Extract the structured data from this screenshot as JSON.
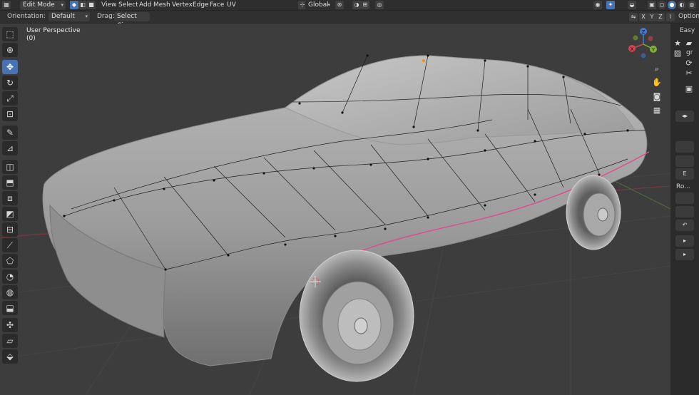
{
  "header": {
    "mode": "Edit Mode",
    "menus": [
      "View",
      "Select",
      "Add",
      "Mesh",
      "Vertex",
      "Edge",
      "Face",
      "UV"
    ],
    "transform_orientation": "Global",
    "axes": [
      "X",
      "Y",
      "Z"
    ],
    "options_label": "Options"
  },
  "tool_settings": {
    "orientation_label": "Orientation:",
    "orientation_value": "Default",
    "drag_label": "Drag:",
    "drag_value": "Select Cir..."
  },
  "viewport": {
    "view_name": "User Perspective",
    "view_sub": "(0)",
    "gizmo_axes": [
      "Z",
      "X",
      "Y"
    ],
    "colors": {
      "x_axis": "#d64352",
      "y_axis": "#7fb32e",
      "z_axis": "#3f7ad6",
      "seam": "#e0488f",
      "mesh": "#b8b8b8"
    }
  },
  "left_toolbar": {
    "tools": [
      "select-box",
      "cursor",
      "move",
      "rotate",
      "scale",
      "transform",
      "annotate",
      "measure",
      "add-cube",
      "extrude",
      "inset",
      "bevel",
      "loop-cut",
      "knife",
      "poly-build",
      "spin",
      "smooth",
      "edge-slide",
      "shrink-fatten",
      "shear",
      "rip"
    ]
  },
  "right_panel": {
    "tab_label": "Easy",
    "snippet_gr": "gr",
    "e_label": "E",
    "ro_label": "Ro..."
  }
}
